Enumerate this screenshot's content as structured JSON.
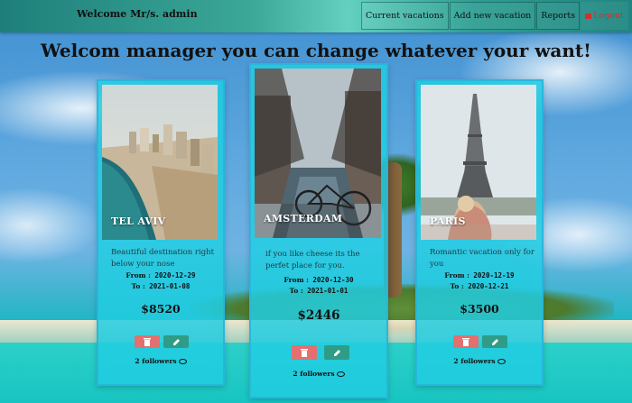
{
  "header": {
    "welcome": "Welcome Mr/s. admin",
    "nav": [
      {
        "label": "Current vacations"
      },
      {
        "label": "Add new vacation"
      },
      {
        "label": "Reports"
      },
      {
        "label": "Logout"
      }
    ]
  },
  "main": {
    "title": "Welcom manager you can change whatever your want!"
  },
  "vacations": [
    {
      "destination": "TEL AVIV",
      "description": "Beautiful destination right below your nose",
      "from_label": "From :",
      "from": "2020-12-29",
      "to_label": "To :",
      "to": "2021-01-08",
      "price": "$8520",
      "followers": "2 followers"
    },
    {
      "destination": "AMSTERDAM",
      "description": "if you like cheese its the perfet place for you.",
      "from_label": "From :",
      "from": "2020-12-30",
      "to_label": "To :",
      "to": "2021-01-01",
      "price": "$2446",
      "followers": "2 followers"
    },
    {
      "destination": "PARIS",
      "description": "Romantic vacation only for you",
      "from_label": "From :",
      "from": "2020-12-19",
      "to_label": "To :",
      "to": "2020-12-21",
      "price": "$3500",
      "followers": "2 followers"
    }
  ],
  "icons": {
    "delete": "trash-icon",
    "edit": "pencil-icon",
    "followers": "eye-icon",
    "logout": "logout-icon"
  },
  "colors": {
    "card_bg": "#21cde1",
    "delete_button": "#e36f6f",
    "edit_button": "#2e9c87",
    "logout_text": "#d0312d"
  }
}
